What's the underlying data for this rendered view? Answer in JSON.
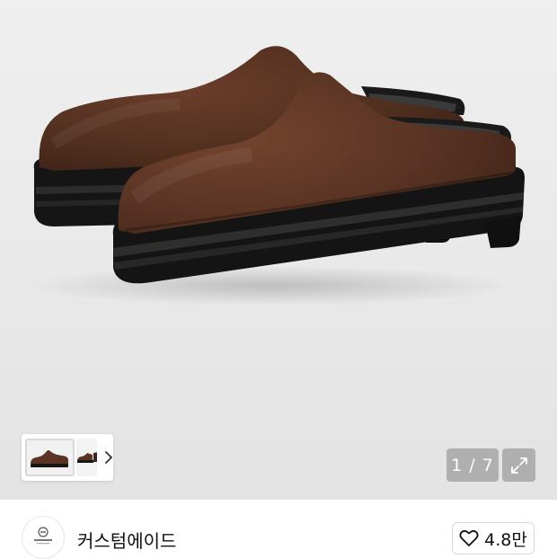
{
  "gallery": {
    "counter": "1 / 7",
    "current_index": 1,
    "total_images": 7
  },
  "shop": {
    "name": "커스텀에이드",
    "logo_text": "CUSTOM-AID"
  },
  "like": {
    "count": "4.8만"
  },
  "icons": {
    "thumb_arrow": "chevron-right-icon",
    "expand": "expand-icon",
    "like": "heart-outline-icon"
  },
  "colors": {
    "suede": "#4d2a1e",
    "sole": "#151515",
    "background": "#ebebeb"
  }
}
